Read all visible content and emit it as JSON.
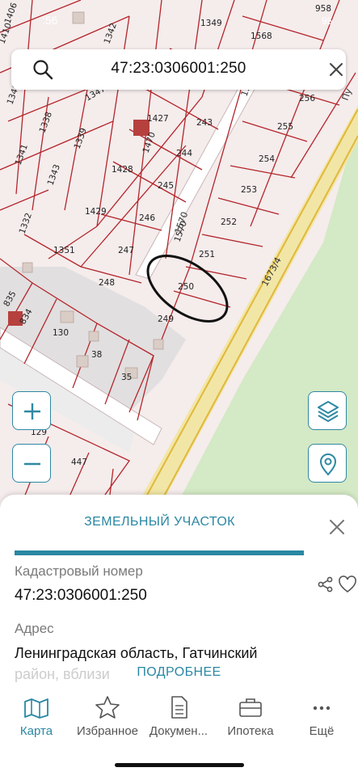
{
  "search": {
    "query": "47:23:0306001:250",
    "search_icon": "search-icon",
    "clear_icon": "close-icon"
  },
  "map": {
    "status_overlay": ":56",
    "battery": "95",
    "road_label_1": "1569",
    "road_label_2": "1570",
    "road_label_3": "1673/4",
    "road_label_4": "Пу",
    "parcel_labels": [
      "1406",
      "1410",
      "1349",
      "958",
      "1342",
      "1568",
      "1347",
      "1348",
      "1338",
      "1339",
      "1427",
      "243",
      "256",
      "255",
      "1470",
      "244",
      "254",
      "1341",
      "1343",
      "1428",
      "245",
      "253",
      "1429",
      "246",
      "252",
      "1332",
      "1570",
      "1351",
      "247",
      "251",
      "248",
      "250",
      "835",
      "834",
      "249",
      "130",
      "38",
      "35",
      "129",
      "447"
    ],
    "highlighted_parcel": "250"
  },
  "map_controls": {
    "zoom_in": "+",
    "zoom_out": "−",
    "layers_icon": "layers-icon",
    "location_icon": "location-pin-icon"
  },
  "sheet": {
    "title": "ЗЕМЕЛЬНЫЙ УЧАСТОК",
    "cadastral_label": "Кадастровый номер",
    "cadastral_value": "47:23:0306001:250",
    "address_label": "Адрес",
    "address_line1": "Ленинградская область, Гатчинский",
    "address_line2": "район, вблизи",
    "more_label": "ПОДРОБНЕЕ",
    "accent": "#2a87a3"
  },
  "tabs": [
    {
      "label": "Карта",
      "icon": "map-icon",
      "active": true
    },
    {
      "label": "Избранное",
      "icon": "star-icon",
      "active": false
    },
    {
      "label": "Докумен...",
      "icon": "document-icon",
      "active": false
    },
    {
      "label": "Ипотека",
      "icon": "briefcase-icon",
      "active": false
    },
    {
      "label": "Ещё",
      "icon": "more-dots-icon",
      "active": false
    }
  ]
}
